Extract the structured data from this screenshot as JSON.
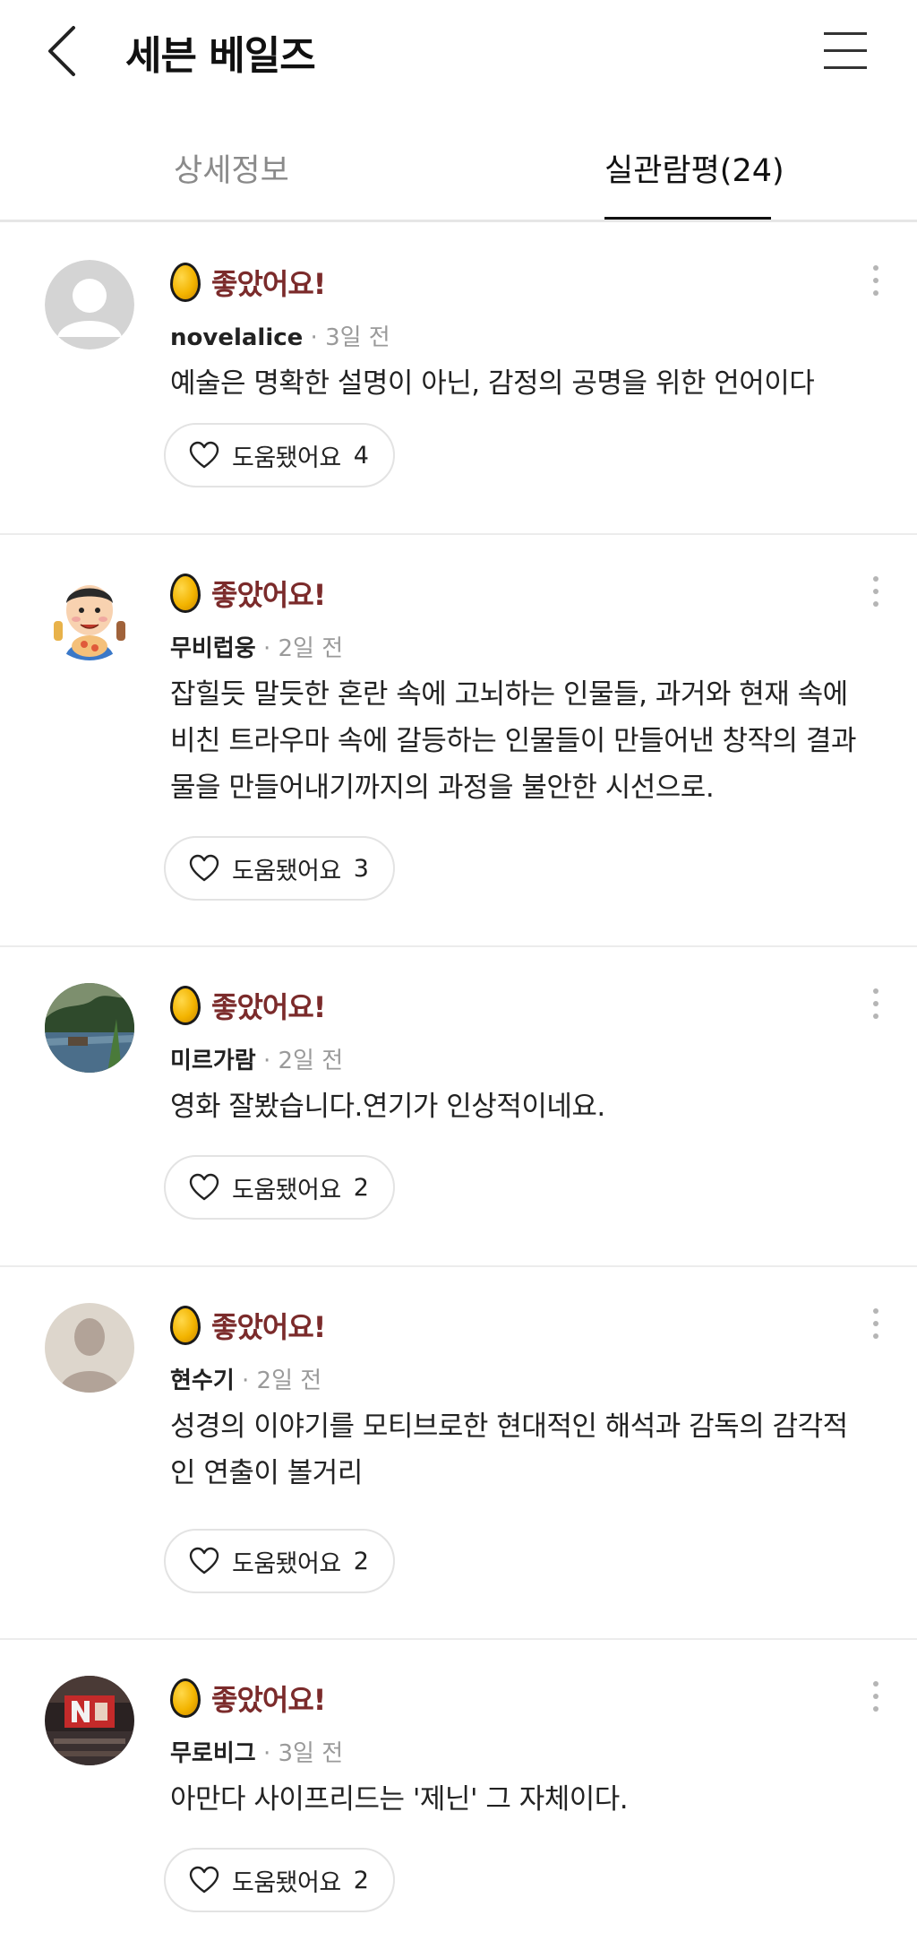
{
  "header": {
    "title": "세븐 베일즈",
    "back_icon": "chevron-left-icon",
    "menu_icon": "hamburger-menu-icon"
  },
  "tabs": [
    {
      "label": "상세정보",
      "active": false
    },
    {
      "label": "실관람평(24)",
      "active": true
    }
  ],
  "reviews": [
    {
      "rating": "좋았어요!",
      "username": "novelalice",
      "time": "· 3일 전",
      "text": "예술은 명확한 설명이 아닌, 감정의 공명을 위한 언어이다",
      "helpful_label": "도움됐어요",
      "helpful_count": "4",
      "avatar": "default-user-icon"
    },
    {
      "rating": "좋았어요!",
      "username": "무비럽웅",
      "time": "· 2일 전",
      "text": "잡힐듯 말듯한 혼란 속에 고뇌하는 인물들, 과거와 현재 속에 비친 트라우마 속에 갈등하는 인물들이 만들어낸 창작의 결과물을 만들어내기까지의 과정을 불안한 시선으로.",
      "helpful_label": "도움됐어요",
      "helpful_count": "3",
      "avatar": "cartoon-character-avatar"
    },
    {
      "rating": "좋았어요!",
      "username": "미르가람",
      "time": "· 2일 전",
      "text": "영화 잘봤습니다.연기가 인상적이네요.",
      "helpful_label": "도움됐어요",
      "helpful_count": "2",
      "avatar": "landscape-photo-avatar"
    },
    {
      "rating": "좋았어요!",
      "username": "현수기",
      "time": "· 2일 전",
      "text": "성경의 이야기를 모티브로한 현대적인 해석과 감독의 감각적인 연출이 볼거리",
      "helpful_label": "도움됐어요",
      "helpful_count": "2",
      "avatar": "silhouette-avatar"
    },
    {
      "rating": "좋았어요!",
      "username": "무로비그",
      "time": "· 3일 전",
      "text": "아만다 사이프리드는 '제닌' 그 자체이다.",
      "helpful_label": "도움됐어요",
      "helpful_count": "2",
      "avatar": "theater-photo-avatar"
    }
  ],
  "colors": {
    "rating_text": "#7b2b2b",
    "egg_fill": "#f3b400",
    "divider": "#ececec",
    "muted_text": "#9a9a9a"
  }
}
